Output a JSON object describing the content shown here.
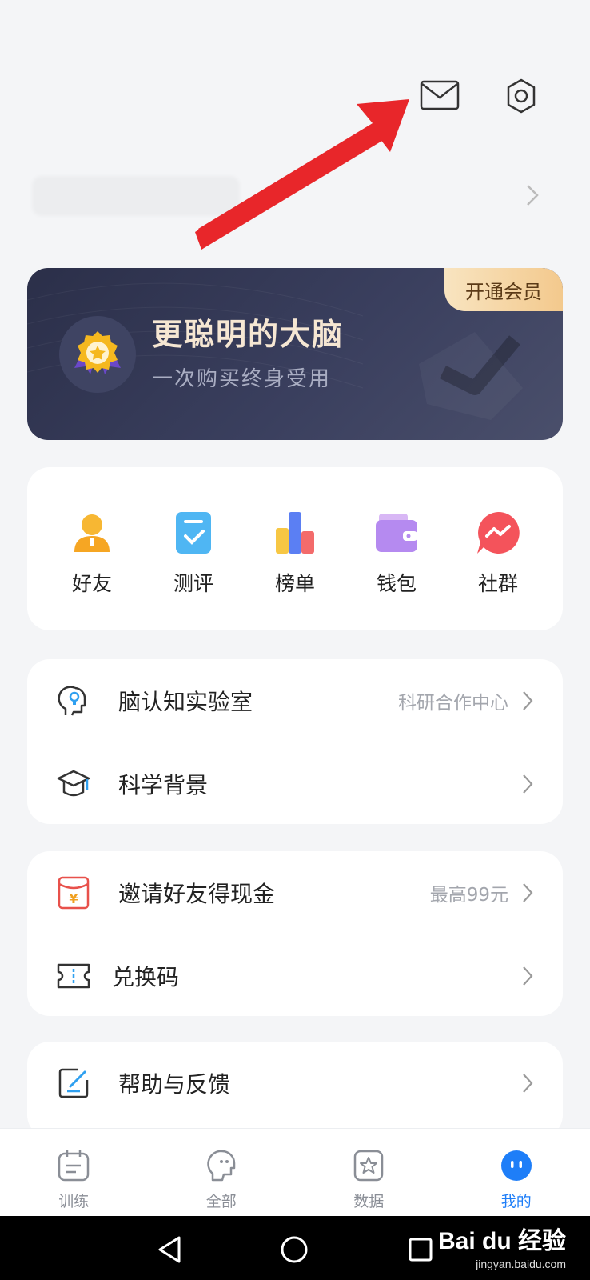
{
  "vip": {
    "title": "更聪明的大脑",
    "subtitle": "一次购买终身受用",
    "open_label": "开通会员",
    "colors": {
      "accent": "#f3c98d",
      "bg": "#2b2f49"
    }
  },
  "quick_actions": [
    {
      "label": "好友",
      "icon": "user-icon"
    },
    {
      "label": "测评",
      "icon": "checklist-icon"
    },
    {
      "label": "榜单",
      "icon": "ranking-chart-icon"
    },
    {
      "label": "钱包",
      "icon": "wallet-icon"
    },
    {
      "label": "社群",
      "icon": "chat-bubble-icon"
    }
  ],
  "lab_menu": [
    {
      "label": "脑认知实验室",
      "extra": "科研合作中心",
      "icon": "brain-bulb-icon"
    },
    {
      "label": "科学背景",
      "extra": "",
      "icon": "graduation-cap-icon"
    }
  ],
  "invite_menu": [
    {
      "label": "邀请好友得现金",
      "extra": "最高99元",
      "icon": "red-envelope-icon"
    },
    {
      "label": "兑换码",
      "extra": "",
      "icon": "ticket-icon"
    }
  ],
  "help_menu": [
    {
      "label": "帮助与反馈",
      "extra": "",
      "icon": "edit-feedback-icon"
    }
  ],
  "tabs": [
    {
      "label": "训练",
      "icon": "calendar-icon",
      "active": false
    },
    {
      "label": "全部",
      "icon": "head-icon",
      "active": false
    },
    {
      "label": "数据",
      "icon": "star-badge-icon",
      "active": false
    },
    {
      "label": "我的",
      "icon": "face-icon",
      "active": true
    }
  ],
  "watermark": {
    "brand": "Bai du 经验",
    "url": "jingyan.baidu.com"
  },
  "colors": {
    "active_tab": "#1e7ef8",
    "annotation_arrow": "#e8262a"
  }
}
